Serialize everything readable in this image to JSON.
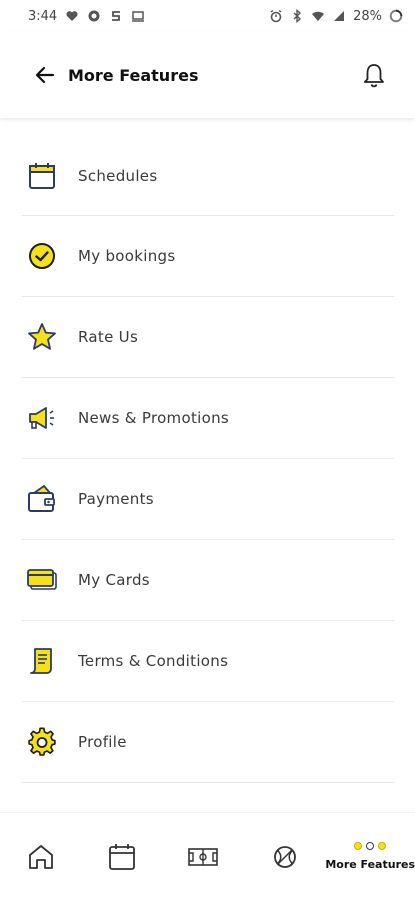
{
  "status_bar": {
    "time": "3:44",
    "battery": "28%",
    "left_icons": [
      "heart-icon",
      "globe-icon",
      "s-icon",
      "cast-icon"
    ],
    "right_icons": [
      "alarm-icon",
      "bluetooth-icon",
      "wifi-icon",
      "signal-icon",
      "battery-icon"
    ]
  },
  "header": {
    "title": "More Features",
    "back_icon": "arrow-left-icon",
    "bell_icon": "bell-icon"
  },
  "menu": {
    "items": [
      {
        "label": "Schedules",
        "icon": "calendar-icon"
      },
      {
        "label": "My bookings",
        "icon": "check-circle-icon"
      },
      {
        "label": "Rate Us",
        "icon": "star-icon"
      },
      {
        "label": "News & Promotions",
        "icon": "megaphone-icon"
      },
      {
        "label": "Payments",
        "icon": "wallet-icon"
      },
      {
        "label": "My Cards",
        "icon": "credit-card-icon"
      },
      {
        "label": "Terms & Conditions",
        "icon": "scroll-icon"
      },
      {
        "label": "Profile",
        "icon": "gear-icon"
      }
    ]
  },
  "bottom_nav": {
    "items": [
      {
        "icon": "home-icon"
      },
      {
        "icon": "calendar-icon"
      },
      {
        "icon": "court-icon"
      },
      {
        "icon": "ball-icon"
      },
      {
        "icon": "dots-icon",
        "label": "More Features",
        "active": true
      }
    ]
  },
  "colors": {
    "accent_yellow": "#f5e11b",
    "icon_navy": "#2b3a67",
    "text_dark": "#111111"
  }
}
